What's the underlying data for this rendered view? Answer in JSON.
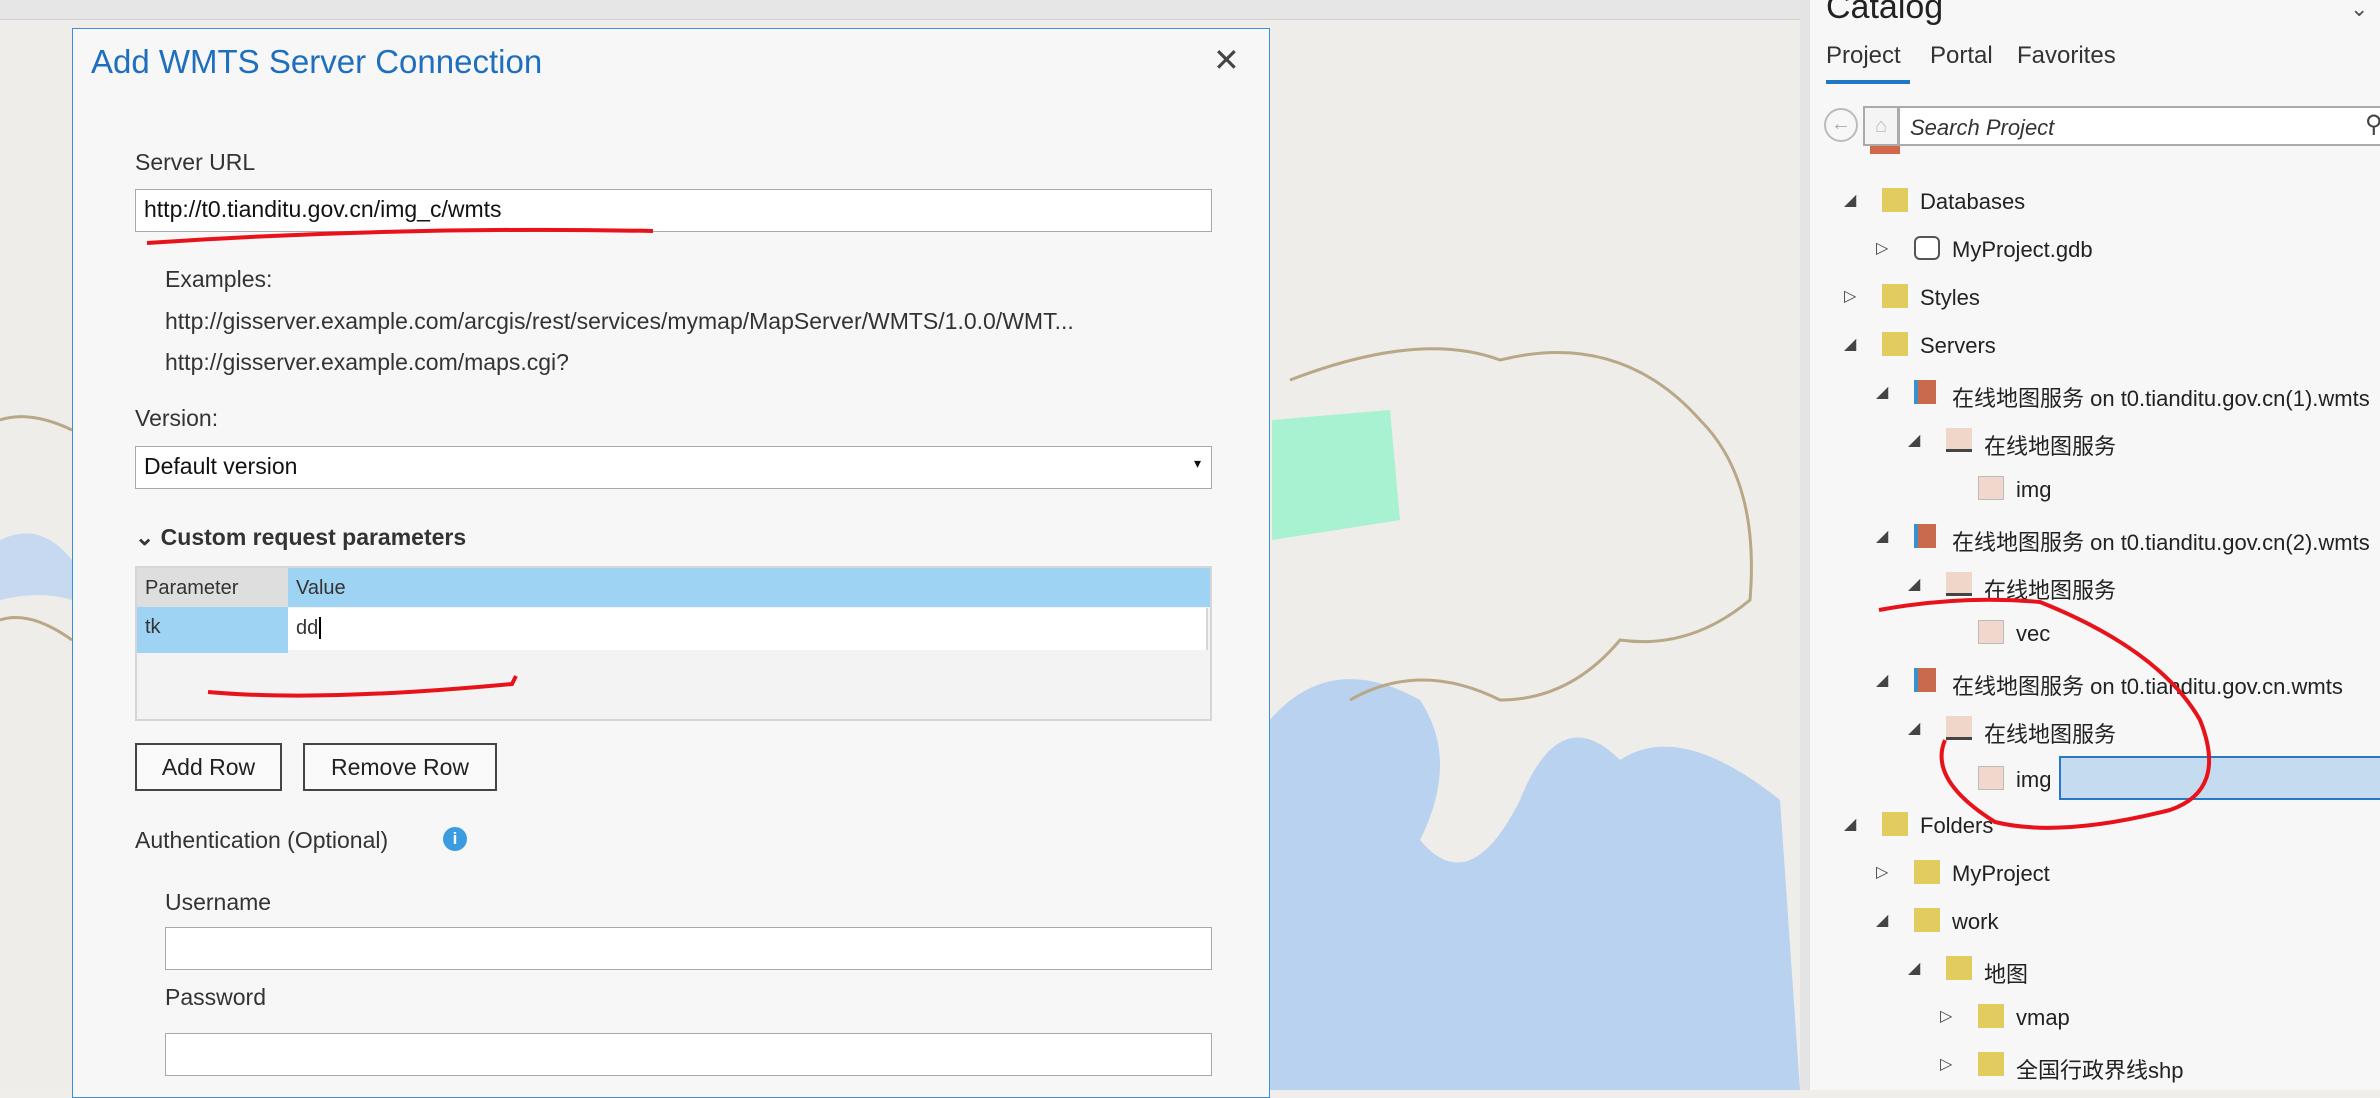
{
  "dialog": {
    "title": "Add WMTS Server Connection",
    "server_url_label": "Server URL",
    "server_url_value": "http://t0.tianditu.gov.cn/img_c/wmts",
    "examples_label": "Examples:",
    "example_1": "http://gisserver.example.com/arcgis/rest/services/mymap/MapServer/WMTS/1.0.0/WMT...",
    "example_2": "http://gisserver.example.com/maps.cgi?",
    "version_label": "Version:",
    "version_value": "Default version",
    "custom_params_label": "Custom request parameters",
    "table": {
      "headers": [
        "Parameter",
        "Value"
      ],
      "rows": [
        {
          "parameter": "tk",
          "value": "dd"
        }
      ]
    },
    "add_row": "Add Row",
    "remove_row": "Remove Row",
    "auth_label": "Authentication (Optional)",
    "username_label": "Username",
    "password_label": "Password"
  },
  "catalog": {
    "title": "Catalog",
    "tabs": [
      "Project",
      "Portal",
      "Favorites"
    ],
    "active_tab": "Project",
    "search_placeholder": "Search Project",
    "tree": [
      {
        "level": 0,
        "exp": "open",
        "icon": "databases-folder-icon",
        "label": "Databases"
      },
      {
        "level": 1,
        "exp": "closed",
        "icon": "geodatabase-icon",
        "label": "MyProject.gdb"
      },
      {
        "level": 0,
        "exp": "closed",
        "icon": "styles-folder-icon",
        "label": "Styles"
      },
      {
        "level": 0,
        "exp": "open",
        "icon": "servers-folder-icon",
        "label": "Servers"
      },
      {
        "level": 1,
        "exp": "open",
        "icon": "wmts-server-icon",
        "label": "在线地图服务 on t0.tianditu.gov.cn(1).wmts"
      },
      {
        "level": 2,
        "exp": "open",
        "icon": "map-service-icon",
        "label": "在线地图服务"
      },
      {
        "level": 3,
        "exp": "none",
        "icon": "layer-icon",
        "label": "img"
      },
      {
        "level": 1,
        "exp": "open",
        "icon": "wmts-server-icon",
        "label": "在线地图服务 on t0.tianditu.gov.cn(2).wmts"
      },
      {
        "level": 2,
        "exp": "open",
        "icon": "map-service-icon",
        "label": "在线地图服务"
      },
      {
        "level": 3,
        "exp": "none",
        "icon": "layer-icon",
        "label": "vec"
      },
      {
        "level": 1,
        "exp": "open",
        "icon": "wmts-server-icon",
        "label": "在线地图服务 on t0.tianditu.gov.cn.wmts"
      },
      {
        "level": 2,
        "exp": "open",
        "icon": "map-service-icon",
        "label": "在线地图服务"
      },
      {
        "level": 3,
        "exp": "none",
        "icon": "layer-icon",
        "label": "img",
        "selected": true
      },
      {
        "level": 0,
        "exp": "open",
        "icon": "folders-icon",
        "label": "Folders"
      },
      {
        "level": 1,
        "exp": "closed",
        "icon": "home-folder-icon",
        "label": "MyProject"
      },
      {
        "level": 1,
        "exp": "open",
        "icon": "folder-icon",
        "label": "work"
      },
      {
        "level": 2,
        "exp": "open",
        "icon": "folder-icon",
        "label": "地图"
      },
      {
        "level": 3,
        "exp": "closed",
        "icon": "folder-icon",
        "label": "vmap"
      },
      {
        "level": 3,
        "exp": "closed",
        "icon": "folder-icon",
        "label": "全国行政界线shp"
      }
    ]
  },
  "colors": {
    "accent": "#1f6fbf",
    "selection": "#c5dbf0",
    "annotation": "#e8121a",
    "table_header": "#9fd3f3"
  }
}
